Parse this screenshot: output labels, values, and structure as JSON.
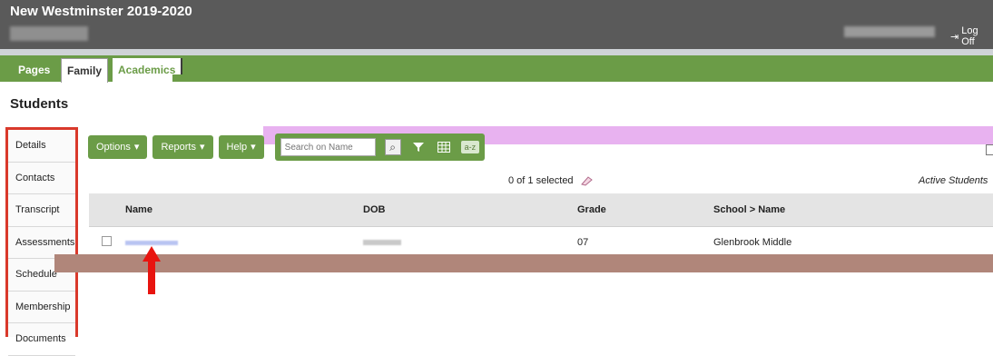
{
  "app": {
    "title": "New Westminster 2019-2020",
    "logoff_label": "Log Off"
  },
  "tabs": [
    {
      "label": "Pages"
    },
    {
      "label": "Family"
    },
    {
      "label": "Academics"
    }
  ],
  "page": {
    "title": "Students"
  },
  "sidebar": {
    "items": [
      {
        "label": "Details"
      },
      {
        "label": "Contacts"
      },
      {
        "label": "Transcript"
      },
      {
        "label": "Assessments"
      },
      {
        "label": "Schedule"
      },
      {
        "label": "Membership"
      },
      {
        "label": "Documents"
      }
    ]
  },
  "toolbar": {
    "options_label": "Options",
    "reports_label": "Reports",
    "help_label": "Help",
    "search_placeholder": "Search on Name",
    "az_label": "a-z"
  },
  "list": {
    "selected_text": "0 of 1 selected",
    "filter_label": "Active Students",
    "columns": [
      "Name",
      "DOB",
      "Grade",
      "School > Name"
    ],
    "rows": [
      {
        "grade": "07",
        "school": "Glenbrook Middle"
      }
    ]
  },
  "colors": {
    "header_bg": "#5a5a5a",
    "accent_green": "#6b9c47",
    "highlight_red": "#d9392b"
  }
}
